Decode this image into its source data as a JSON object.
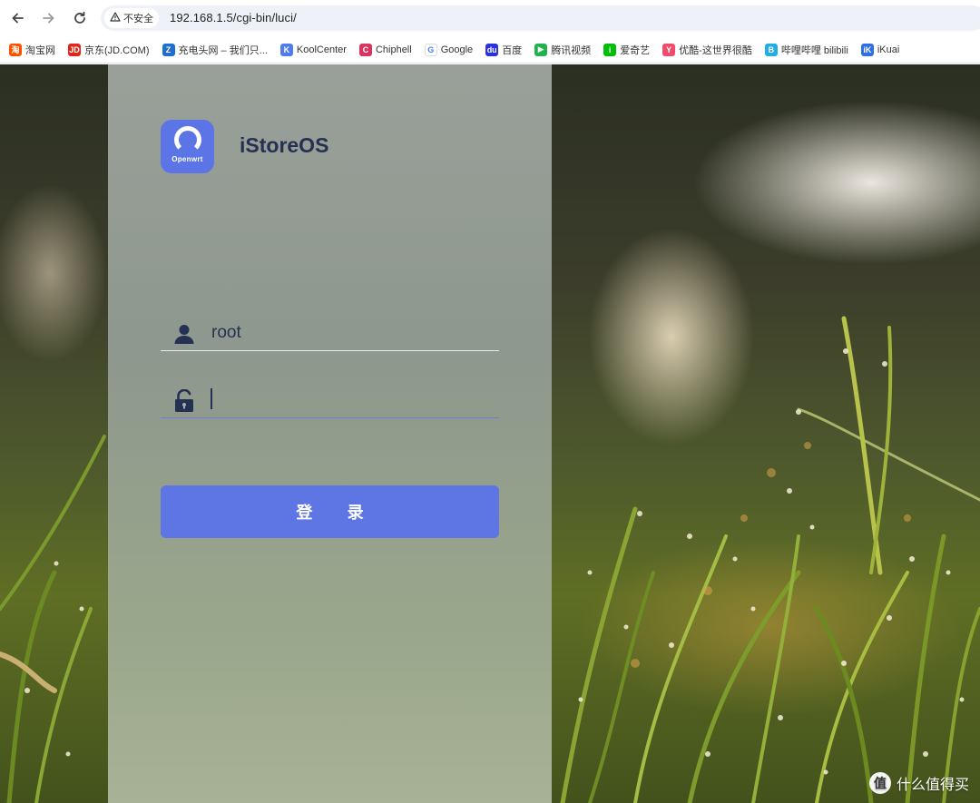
{
  "browser": {
    "security_label": "不安全",
    "url": "192.168.1.5/cgi-bin/luci/",
    "bookmarks": [
      {
        "label": "淘宝网",
        "icon": "taobao-icon",
        "color": "#ff5000",
        "glyph": "淘"
      },
      {
        "label": "京东(JD.COM)",
        "icon": "jd-icon",
        "color": "#e1251b",
        "glyph": "JD"
      },
      {
        "label": "充电头网 – 我们只...",
        "icon": "chongdiantou-icon",
        "color": "#1f6fd1",
        "glyph": "Z"
      },
      {
        "label": "KoolCenter",
        "icon": "koolcenter-icon",
        "color": "#4f7df0",
        "glyph": "K"
      },
      {
        "label": "Chiphell",
        "icon": "chiphell-icon",
        "color": "#d8345f",
        "glyph": "C"
      },
      {
        "label": "Google",
        "icon": "google-icon",
        "color": "#ffffff",
        "glyph": "G"
      },
      {
        "label": "百度",
        "icon": "baidu-icon",
        "color": "#2932e1",
        "glyph": "du"
      },
      {
        "label": "腾讯视频",
        "icon": "tencent-video-icon",
        "color": "#20b34b",
        "glyph": "▶"
      },
      {
        "label": "爱奇艺",
        "icon": "iqiyi-icon",
        "color": "#00be06",
        "glyph": "i"
      },
      {
        "label": "优酷-这世界很酷",
        "icon": "youku-icon",
        "color": "#f04b6d",
        "glyph": "Y"
      },
      {
        "label": "哔哩哔哩 bilibili",
        "icon": "bilibili-icon",
        "color": "#23ade5",
        "glyph": "B"
      },
      {
        "label": "iKuai",
        "icon": "ikuai-icon",
        "color": "#2f6ee6",
        "glyph": "iK"
      }
    ]
  },
  "login": {
    "logo_caption": "Openwrt",
    "brand": "iStoreOS",
    "username": "root",
    "password": "",
    "submit_label": "登 录",
    "accent": "#5d76e3"
  },
  "watermark": {
    "badge": "值",
    "text": "什么值得买"
  }
}
